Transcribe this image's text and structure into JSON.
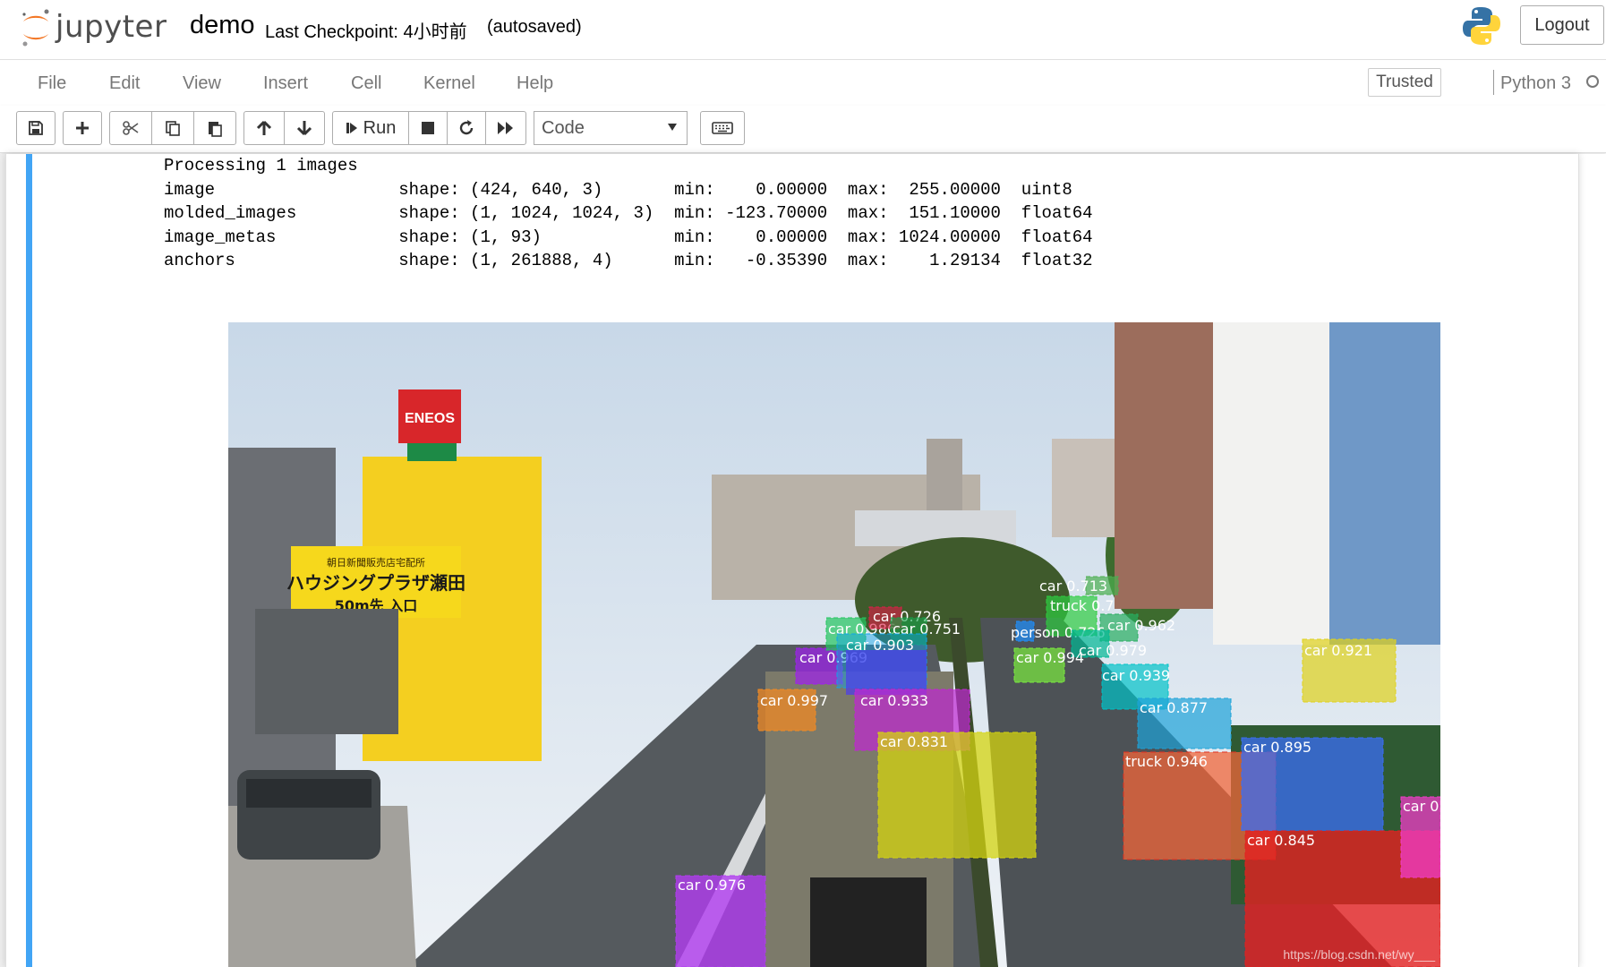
{
  "header": {
    "logo_text": "jupyter",
    "notebook_name": "demo",
    "checkpoint": "Last Checkpoint: 4小时前",
    "autosave_status": "(autosaved)",
    "logout_label": "Logout"
  },
  "menubar": {
    "items": [
      "File",
      "Edit",
      "View",
      "Insert",
      "Cell",
      "Kernel",
      "Help"
    ],
    "trusted_label": "Trusted",
    "kernel_name": "Python 3"
  },
  "toolbar": {
    "run_label": "Run",
    "cell_type": "Code",
    "icons": [
      "save-icon",
      "plus-icon",
      "cut-icon",
      "copy-icon",
      "paste-icon",
      "arrow-up-icon",
      "arrow-down-icon",
      "step-forward-icon",
      "stop-icon",
      "restart-icon",
      "fast-forward-icon",
      "keyboard-icon"
    ]
  },
  "output": {
    "lines": [
      "Processing 1 images",
      "image                  shape: (424, 640, 3)       min:    0.00000  max:  255.00000  uint8",
      "molded_images          shape: (1, 1024, 1024, 3)  min: -123.70000  max:  151.10000  float64",
      "image_metas            shape: (1, 93)             min:    0.00000  max: 1024.00000  float64",
      "anchors                shape: (1, 261888, 4)      min:   -0.35390  max:    1.29134  float32"
    ]
  },
  "image": {
    "signs": {
      "eneos": "ENEOS",
      "billboard_top": "朝日新聞販売店宅配所",
      "billboard_main": "ハウジングプラザ瀬田",
      "billboard_bottom": "50m先 入口"
    },
    "detections": [
      {
        "label": "car 0.713",
        "color": "#4caf50"
      },
      {
        "label": "truck 0.7",
        "color": "#2ecc40"
      },
      {
        "label": "car 0.962",
        "color": "#27ae60"
      },
      {
        "label": "person 0.726",
        "color": "#1e90ff"
      },
      {
        "label": "car 0.979",
        "color": "#00b894"
      },
      {
        "label": "car 0.994",
        "color": "#7bed3f"
      },
      {
        "label": "car 0.939",
        "color": "#00c2c7"
      },
      {
        "label": "car 0.877",
        "color": "#1ca3d8"
      },
      {
        "label": "car 0.921",
        "color": "#e0d21a"
      },
      {
        "label": "car 0.969",
        "color": "#a020f0"
      },
      {
        "label": "car 0.986",
        "color": "#22c55e"
      },
      {
        "label": "car 0.726",
        "color": "#e11d48"
      },
      {
        "label": "car 0.751",
        "color": "#16a34a"
      },
      {
        "label": "car 0.903",
        "color": "#0ea5e9"
      },
      {
        "label": "car 0.997",
        "color": "#f08a24"
      },
      {
        "label": "car 0.933",
        "color": "#c026d3"
      },
      {
        "label": "car 0.831",
        "color": "#d4d40f"
      },
      {
        "label": "truck 0.946",
        "color": "#f0653a"
      },
      {
        "label": "car 0.895",
        "color": "#3b6df5"
      },
      {
        "label": "car 0.845",
        "color": "#e32020"
      },
      {
        "label": "car 0",
        "color": "#f03cc8"
      },
      {
        "label": "car 0.976",
        "color": "#b13cf0"
      }
    ],
    "watermark": "https://blog.csdn.net/wy___"
  }
}
